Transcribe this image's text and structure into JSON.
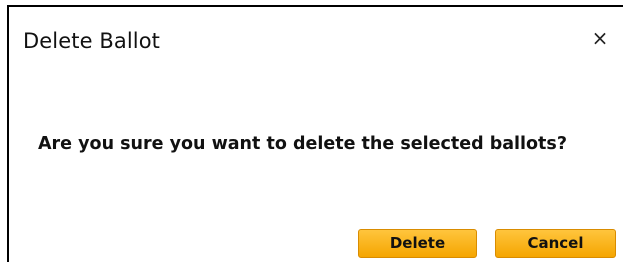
{
  "dialog": {
    "title": "Delete Ballot",
    "close_glyph": "×",
    "message": "Are you sure you want to delete the selected ballots?",
    "delete_label": "Delete",
    "cancel_label": "Cancel",
    "accent_color": "#f5a500"
  }
}
